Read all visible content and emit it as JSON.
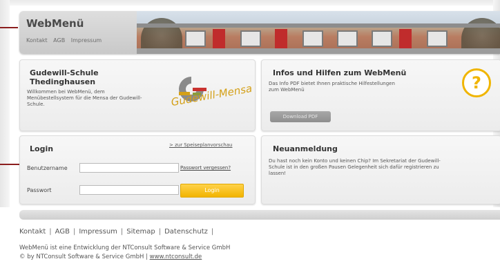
{
  "header": {
    "title": "WebMenü",
    "nav": [
      "Kontakt",
      "AGB",
      "Impressum"
    ]
  },
  "school": {
    "title_line1": "Gudewill-Schule",
    "title_line2": "Thedinghausen",
    "description": "Willkommen bei WebMenü, dem Menübestellsystem für die Mensa der Gudewill-Schule.",
    "logo_text": "Gudewill-Mensa"
  },
  "info": {
    "title": "Infos und Hilfen zum WebMenü",
    "description": "Das Info PDF bietet Ihnen praktische Hilfestellungen zum WebMenü",
    "download_label": "Download PDF",
    "help_glyph": "?"
  },
  "login": {
    "title": "Login",
    "preview_link": "> zur Speiseplanvorschau",
    "username_label": "Benutzername",
    "username_value": "",
    "password_label": "Passwort",
    "password_value": "",
    "forgot_link": "Passwort vergessen?",
    "login_button": "Login"
  },
  "registration": {
    "title": "Neuanmeldung",
    "description": "Du hast noch kein Konto und keinen Chip? Im Sekretariat der Gudewill-Schule ist in den großen Pausen Gelegenheit sich dafür registrieren zu lassen!"
  },
  "footer": {
    "nav": [
      "Kontakt",
      "AGB",
      "Impressum",
      "Sitemap",
      "Datenschutz"
    ],
    "line1": "WebMenü ist eine Entwicklung der NTConsult Software & Service GmbH",
    "line2_prefix": "© by NTConsult Software & Service GmbH  |  ",
    "url": "www.ntconsult.de"
  },
  "colors": {
    "accent_yellow": "#f2b400",
    "callout_red": "#8b1e1e",
    "panel_bg": "#f2f2f2"
  },
  "icons": [
    "help-icon",
    "mensa-logo"
  ]
}
